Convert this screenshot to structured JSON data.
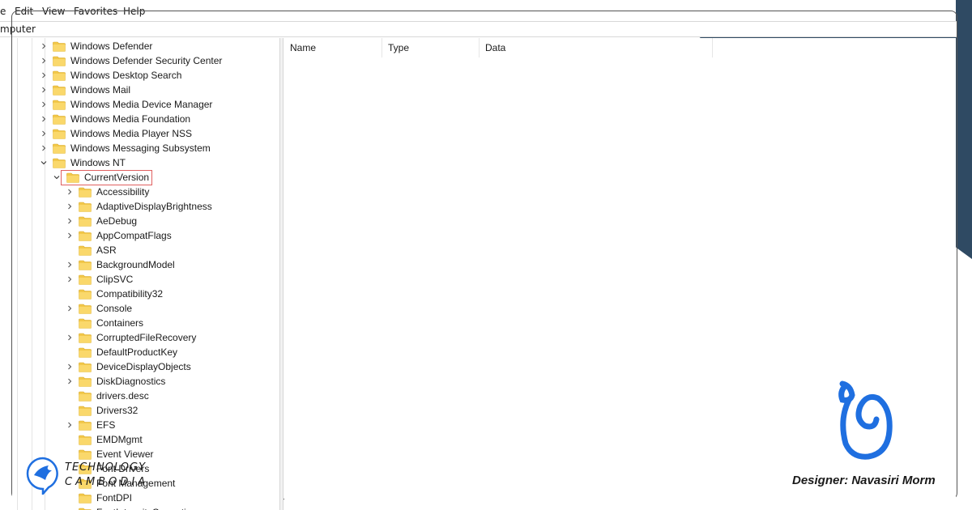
{
  "menu": {
    "items": [
      "e",
      "Edit",
      "View",
      "Favorites",
      "Help"
    ]
  },
  "address": {
    "path": "mputer"
  },
  "tree": {
    "nodes": [
      {
        "label": "Windows Defender",
        "expand": "collapsed"
      },
      {
        "label": "Windows Defender Security Center",
        "expand": "collapsed"
      },
      {
        "label": "Windows Desktop Search",
        "expand": "collapsed"
      },
      {
        "label": "Windows Mail",
        "expand": "collapsed"
      },
      {
        "label": "Windows Media Device Manager",
        "expand": "collapsed"
      },
      {
        "label": "Windows Media Foundation",
        "expand": "collapsed"
      },
      {
        "label": "Windows Media Player NSS",
        "expand": "collapsed"
      },
      {
        "label": "Windows Messaging Subsystem",
        "expand": "collapsed"
      },
      {
        "label": "Windows NT",
        "expand": "expanded"
      },
      {
        "label": "CurrentVersion",
        "expand": "expanded",
        "selected": true
      },
      {
        "label": "Accessibility",
        "expand": "collapsed"
      },
      {
        "label": "AdaptiveDisplayBrightness",
        "expand": "collapsed"
      },
      {
        "label": "AeDebug",
        "expand": "collapsed"
      },
      {
        "label": "AppCompatFlags",
        "expand": "collapsed"
      },
      {
        "label": "ASR",
        "expand": "none"
      },
      {
        "label": "BackgroundModel",
        "expand": "collapsed"
      },
      {
        "label": "ClipSVC",
        "expand": "collapsed"
      },
      {
        "label": "Compatibility32",
        "expand": "none"
      },
      {
        "label": "Console",
        "expand": "collapsed"
      },
      {
        "label": "Containers",
        "expand": "none"
      },
      {
        "label": "CorruptedFileRecovery",
        "expand": "collapsed"
      },
      {
        "label": "DefaultProductKey",
        "expand": "none"
      },
      {
        "label": "DeviceDisplayObjects",
        "expand": "collapsed"
      },
      {
        "label": "DiskDiagnostics",
        "expand": "collapsed"
      },
      {
        "label": "drivers.desc",
        "expand": "none"
      },
      {
        "label": "Drivers32",
        "expand": "none"
      },
      {
        "label": "EFS",
        "expand": "collapsed"
      },
      {
        "label": "EMDMgmt",
        "expand": "none"
      },
      {
        "label": "Event Viewer",
        "expand": "none"
      },
      {
        "label": "Font Drivers",
        "expand": "none"
      },
      {
        "label": "Font Management",
        "expand": "none"
      },
      {
        "label": "FontDPI",
        "expand": "none"
      },
      {
        "label": "FontIntensityCorrection",
        "expand": "none"
      }
    ]
  },
  "values": {
    "columns": [
      "Name",
      "Type",
      "Data"
    ]
  },
  "branding": {
    "line1": "TECHNOLOGY",
    "line2": "CAMBODIA",
    "designer": "Designer: Navasiri Morm"
  },
  "colors": {
    "deco_navy": "#2f4a63",
    "folder": "#f2c84b",
    "selection_border": "#e06060",
    "brand_blue": "#1f6fe0"
  },
  "icons": {
    "expand_collapsed": "chevron-right-icon",
    "expand_expanded": "chevron-down-icon",
    "node": "folder-icon"
  }
}
